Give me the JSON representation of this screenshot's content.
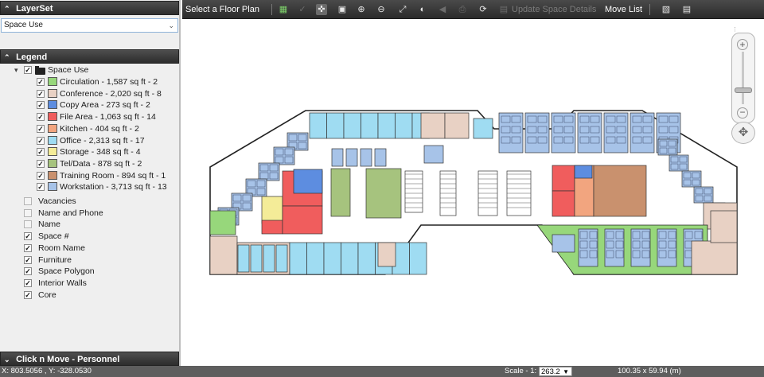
{
  "layerset": {
    "header": "LayerSet",
    "selected": "Space Use"
  },
  "legend": {
    "header": "Legend",
    "root_label": "Space Use",
    "items": [
      {
        "label": "Circulation - 1,587 sq ft - 2",
        "color": "#97d77b"
      },
      {
        "label": "Conference - 2,020 sq ft - 8",
        "color": "#e8d1c4"
      },
      {
        "label": "Copy Area - 273 sq ft - 2",
        "color": "#5d8de0"
      },
      {
        "label": "File Area - 1,063 sq ft - 14",
        "color": "#f05d5d"
      },
      {
        "label": "Kitchen - 404 sq ft - 2",
        "color": "#f2a57f"
      },
      {
        "label": "Office - 2,313 sq ft - 17",
        "color": "#9fdcf2"
      },
      {
        "label": "Storage - 348 sq ft - 4",
        "color": "#f4ec98"
      },
      {
        "label": "Tel/Data - 878 sq ft - 2",
        "color": "#a6c37e"
      },
      {
        "label": "Training Room - 894 sq ft - 1",
        "color": "#c9916e"
      },
      {
        "label": "Workstation - 3,713 sq ft - 13",
        "color": "#a7c3e8"
      }
    ],
    "layers": [
      {
        "label": "Vacancies",
        "checked": false
      },
      {
        "label": "Name and Phone",
        "checked": false
      },
      {
        "label": "Name",
        "checked": false
      },
      {
        "label": "Space #",
        "checked": true
      },
      {
        "label": "Room Name",
        "checked": true
      },
      {
        "label": "Furniture",
        "checked": true
      },
      {
        "label": "Space Polygon",
        "checked": true
      },
      {
        "label": "Interior Walls",
        "checked": true
      },
      {
        "label": "Core",
        "checked": true
      }
    ]
  },
  "click_move": {
    "header": "Click n Move - Personnel"
  },
  "toolbar": {
    "select_floor": "Select a Floor Plan",
    "update_space": "Update Space Details",
    "move_list": "Move List"
  },
  "status": {
    "coords": "X: 803.5056 , Y: -328.0530",
    "scale_label": "Scale - 1:",
    "scale_value": "263.2",
    "dims": "100.35 x 59.94 (m)"
  },
  "colors": {
    "office": "#9fdcf2",
    "workstation": "#a7c3e8",
    "circulation": "#97d77b",
    "conference": "#e8d1c4",
    "file": "#f05d5d",
    "kitchen": "#f2a57f",
    "training": "#c9916e",
    "teldata": "#a6c37e",
    "storage": "#f4ec98",
    "copy": "#5d8de0"
  }
}
